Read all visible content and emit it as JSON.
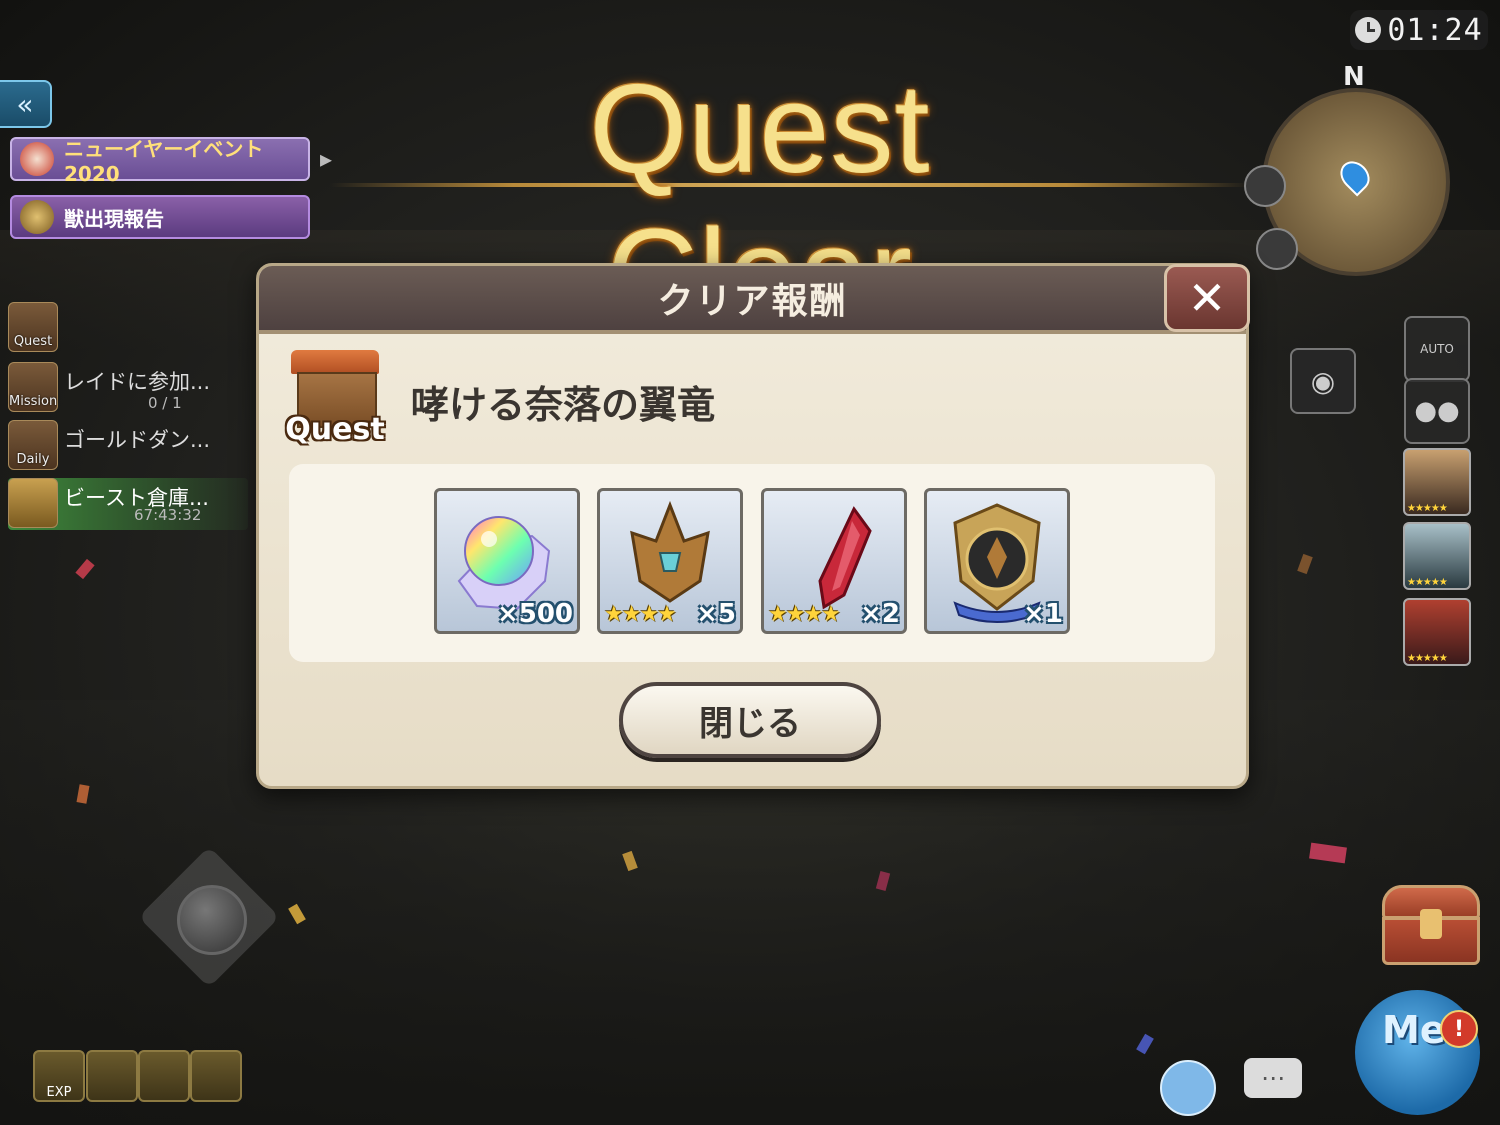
{
  "timer": {
    "value": "01:24"
  },
  "header": {
    "title": "Quest Clear"
  },
  "sidebar": {
    "back_icon": "double-chevron-left",
    "banners": [
      {
        "label": "ニューイヤーイベント2020",
        "icon": "daruma-icon"
      },
      {
        "label": "獣出現報告",
        "icon": "beast-mask-icon"
      }
    ],
    "missions": [
      {
        "category": "Quest",
        "text": "",
        "progress": ""
      },
      {
        "category": "Mission",
        "text": "レイドに参加...",
        "progress": "0 / 1"
      },
      {
        "category": "Daily",
        "text": "ゴールドダン...",
        "progress": ""
      },
      {
        "category": "",
        "text": "ビースト倉庫...",
        "progress": "67:43:32"
      }
    ]
  },
  "minimap": {
    "north_label": "N"
  },
  "right_panel": {
    "auto_label": "AUTO"
  },
  "modal": {
    "title": "クリア報酬",
    "close_icon": "close-x",
    "quest_badge": "Quest",
    "quest_name": "哮ける奈落の翼竜",
    "rewards": [
      {
        "name": "rainbow-crystal",
        "count": "×500",
        "stars": ""
      },
      {
        "name": "bronze-helm",
        "count": "×5",
        "stars": "★★★★"
      },
      {
        "name": "red-feather",
        "count": "×2",
        "stars": "★★★★"
      },
      {
        "name": "crest-emblem",
        "count": "×1",
        "stars": ""
      }
    ],
    "close_button": "閉じる"
  },
  "buffs": [
    {
      "label": "EXP"
    },
    {
      "label": ""
    },
    {
      "label": ""
    },
    {
      "label": ""
    }
  ],
  "bottom_right": {
    "menu_label": "Me",
    "alert": "!"
  },
  "colors": {
    "title_gold": "#f6e08c",
    "modal_header": "#4e4140",
    "modal_bg": "#f2ecdd",
    "reward_count_outline": "#24506e",
    "star_color": "#ffd43b"
  }
}
